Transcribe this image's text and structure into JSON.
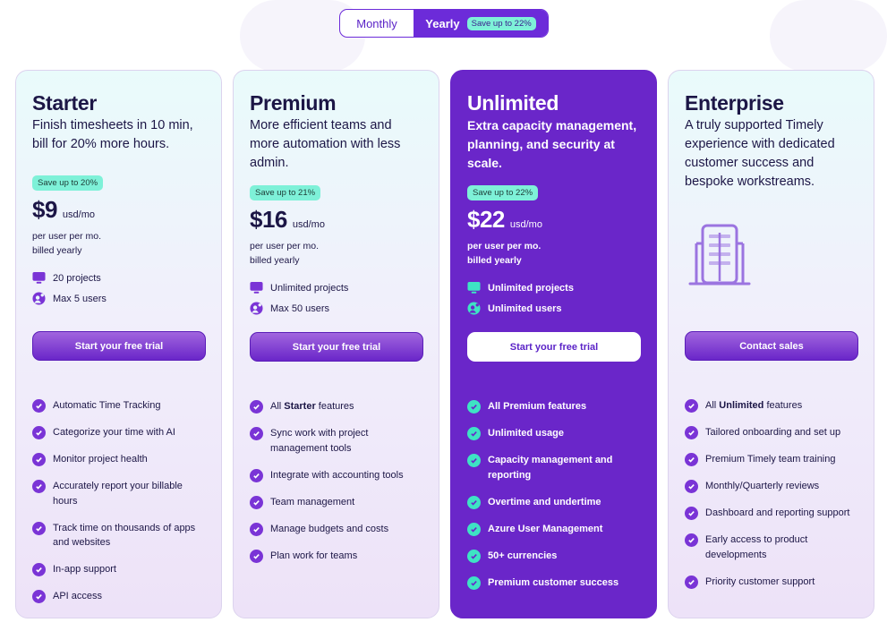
{
  "billing_toggle": {
    "monthly_label": "Monthly",
    "yearly_label": "Yearly",
    "yearly_badge": "Save up to 22%",
    "selected": "Yearly"
  },
  "colors": {
    "brand_purple": "#6a26c9",
    "badge_mint": "#7ef1d8",
    "check_dark_bg": "#3ee3c4"
  },
  "plans": [
    {
      "name": "Starter",
      "description": "Finish timesheets in 10 min, bill for 20% more hours.",
      "save_badge": "Save up to 20%",
      "price": "$9",
      "price_unit": "usd/mo",
      "price_note_1": "per user per mo.",
      "price_note_2": "billed yearly",
      "limits": [
        {
          "icon": "monitor-icon",
          "text": "20 projects"
        },
        {
          "icon": "users-icon",
          "text": "Max 5 users"
        }
      ],
      "cta": "Start your free trial",
      "features": [
        {
          "prefix": "",
          "bold": "",
          "text": "Automatic Time Tracking"
        },
        {
          "prefix": "",
          "bold": "",
          "text": "Categorize your time with AI"
        },
        {
          "prefix": "",
          "bold": "",
          "text": "Monitor project health"
        },
        {
          "prefix": "",
          "bold": "",
          "text": "Accurately report your billable hours"
        },
        {
          "prefix": "",
          "bold": "",
          "text": "Track time on thousands of apps and websites"
        },
        {
          "prefix": "",
          "bold": "",
          "text": "In-app support"
        },
        {
          "prefix": "",
          "bold": "",
          "text": "API access"
        }
      ]
    },
    {
      "name": "Premium",
      "description": "More efficient teams and more automation with less admin.",
      "save_badge": "Save up to 21%",
      "price": "$16",
      "price_unit": "usd/mo",
      "price_note_1": "per user per mo.",
      "price_note_2": "billed yearly",
      "limits": [
        {
          "icon": "monitor-icon",
          "text": "Unlimited projects"
        },
        {
          "icon": "users-icon",
          "text": "Max 50 users"
        }
      ],
      "cta": "Start your free trial",
      "features": [
        {
          "prefix": "All ",
          "bold": "Starter",
          "text": " features"
        },
        {
          "prefix": "",
          "bold": "",
          "text": "Sync work with project management tools"
        },
        {
          "prefix": "",
          "bold": "",
          "text": "Integrate with accounting tools"
        },
        {
          "prefix": "",
          "bold": "",
          "text": "Team management"
        },
        {
          "prefix": "",
          "bold": "",
          "text": "Manage budgets and costs"
        },
        {
          "prefix": "",
          "bold": "",
          "text": "Plan work for teams"
        }
      ]
    },
    {
      "name": "Unlimited",
      "description": "Extra capacity management, planning, and security at scale.",
      "save_badge": "Save up to 22%",
      "price": "$22",
      "price_unit": "usd/mo",
      "price_note_1": "per user per mo.",
      "price_note_2": "billed yearly",
      "limits": [
        {
          "icon": "monitor-icon",
          "text": "Unlimited projects"
        },
        {
          "icon": "users-icon",
          "text": "Unlimited users"
        }
      ],
      "cta": "Start your free trial",
      "features": [
        {
          "prefix": "All ",
          "bold": "Premium",
          "text": " features"
        },
        {
          "prefix": "",
          "bold": "",
          "text": "Unlimited usage"
        },
        {
          "prefix": "",
          "bold": "",
          "text": "Capacity management and reporting"
        },
        {
          "prefix": "",
          "bold": "",
          "text": "Overtime and undertime"
        },
        {
          "prefix": "",
          "bold": "",
          "text": "Azure User Management"
        },
        {
          "prefix": "",
          "bold": "",
          "text": "50+ currencies"
        },
        {
          "prefix": "",
          "bold": "",
          "text": "Premium customer success"
        }
      ]
    },
    {
      "name": "Enterprise",
      "description": "A truly supported Timely experience with dedicated customer success and bespoke workstreams.",
      "icon": "building-icon",
      "cta": "Contact sales",
      "features": [
        {
          "prefix": "All ",
          "bold": "Unlimited",
          "text": " features"
        },
        {
          "prefix": "",
          "bold": "",
          "text": "Tailored onboarding and set up"
        },
        {
          "prefix": "",
          "bold": "",
          "text": "Premium Timely team training"
        },
        {
          "prefix": "",
          "bold": "",
          "text": "Monthly/Quarterly reviews"
        },
        {
          "prefix": "",
          "bold": "",
          "text": "Dashboard and reporting support"
        },
        {
          "prefix": "",
          "bold": "",
          "text": "Early access to product developments"
        },
        {
          "prefix": "",
          "bold": "",
          "text": "Priority customer support"
        }
      ]
    }
  ]
}
